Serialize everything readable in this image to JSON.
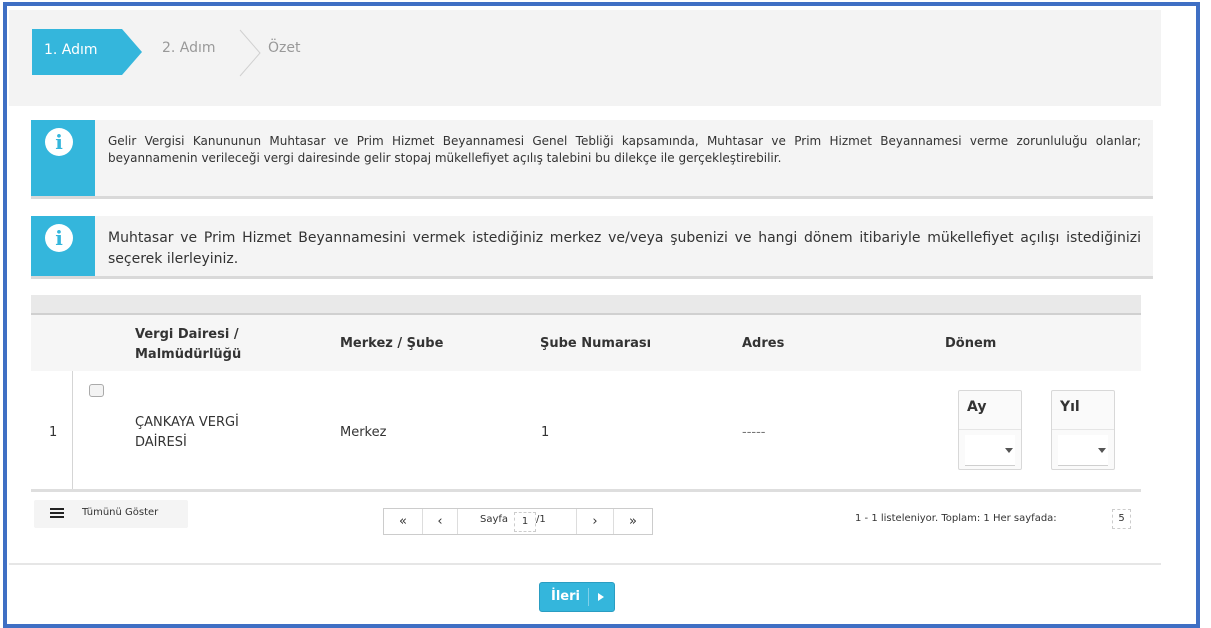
{
  "steps": {
    "step1": "1. Adım",
    "step2": "2. Adım",
    "step3": "Özet"
  },
  "info_boxes": [
    {
      "icon": "info-icon",
      "text": "Gelir Vergisi Kanununun Muhtasar ve Prim Hizmet Beyannamesi Genel Tebliği kapsamında, Muhtasar ve Prim Hizmet Beyannamesi verme zorunluluğu olanlar; beyannamenin verileceği vergi dairesinde gelir stopaj mükellefiyet açılış talebini bu dilekçe ile gerçekleştirebilir."
    },
    {
      "icon": "info-icon",
      "text": "Muhtasar ve Prim Hizmet Beyannamesini vermek istediğiniz merkez ve/veya şubenizi ve hangi dönem itibariyle mükellefiyet açılışı istediğinizi seçerek ilerleyiniz."
    }
  ],
  "table": {
    "headers": {
      "office_line1": "Vergi Dairesi /",
      "office_line2": "Malmüdürlüğü",
      "branch": "Merkez / Şube",
      "branch_no": "Şube Numarası",
      "address": "Adres",
      "period": "Dönem"
    },
    "rows": [
      {
        "index": "1",
        "office_line1": "ÇANKAYA VERGİ",
        "office_line2": "DAİRESİ",
        "branch": "Merkez",
        "branch_no": "1",
        "address": "-----",
        "month_label": "Ay",
        "month_value": "",
        "year_label": "Yıl",
        "year_value": ""
      }
    ]
  },
  "footer": {
    "show_all": "Tümünü Göster",
    "pager": {
      "first": "«",
      "prev": "‹",
      "page_label": "Sayfa",
      "current": "1",
      "total": "/1",
      "next": "›",
      "last": "»"
    },
    "summary": "1 - 1 listeleniyor. Toplam: 1  Her sayfada:",
    "per_page": "5"
  },
  "next_button": "İleri",
  "colors": {
    "accent": "#34b6dc",
    "frame": "#3f6fc4"
  }
}
